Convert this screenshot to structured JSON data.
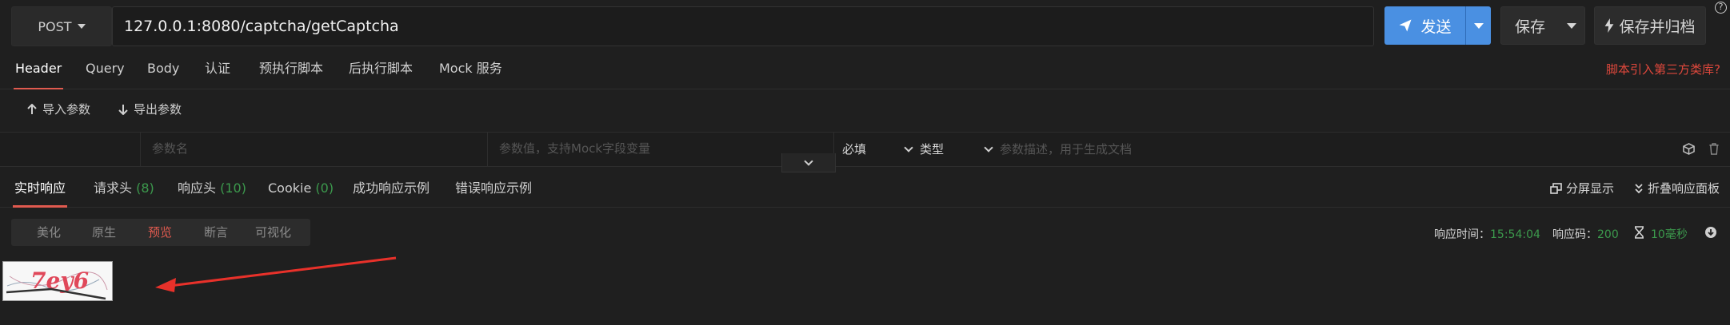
{
  "request": {
    "method": "POST",
    "url": "127.0.0.1:8080/captcha/getCaptcha",
    "send_label": "发送",
    "save_label": "保存",
    "save_template_label": "保存并归档",
    "help_label": "?"
  },
  "request_tabs": [
    {
      "label": "Header",
      "active": true
    },
    {
      "label": "Query"
    },
    {
      "label": "Body"
    },
    {
      "label": "认证"
    },
    {
      "label": "预执行脚本"
    },
    {
      "label": "后执行脚本"
    },
    {
      "label": "Mock 服务"
    }
  ],
  "script_link": "脚本引入第三方类库?",
  "import_label": "导入参数",
  "export_label": "导出参数",
  "param_row": {
    "name_placeholder": "参数名",
    "value_placeholder": "参数值，支持Mock字段变量",
    "required_label": "必填",
    "type_label": "类型",
    "desc_placeholder": "参数描述，用于生成文档"
  },
  "response_tabs": [
    {
      "label": "实时响应",
      "active": true,
      "count": ""
    },
    {
      "label": "请求头",
      "count": "(8)"
    },
    {
      "label": "响应头",
      "count": "(10)"
    },
    {
      "label": "Cookie",
      "count": "(0)"
    },
    {
      "label": "成功响应示例",
      "count": ""
    },
    {
      "label": "错误响应示例",
      "count": ""
    }
  ],
  "split_label": "分屏显示",
  "fold_label": "折叠响应面板",
  "view_modes": [
    {
      "label": "美化"
    },
    {
      "label": "原生"
    },
    {
      "label": "预览",
      "active": true
    },
    {
      "label": "断言"
    },
    {
      "label": "可视化"
    }
  ],
  "response_meta": {
    "time_label": "响应时间：",
    "time_value": "15:54:04",
    "code_label": "响应码：",
    "code_value": "200",
    "duration": "10毫秒"
  },
  "captcha_text": "7ey6",
  "colors": {
    "accent": "#4a90e2",
    "active_tab": "#e05a4f",
    "green": "#3c9a4d",
    "arrow": "#e8312a"
  }
}
